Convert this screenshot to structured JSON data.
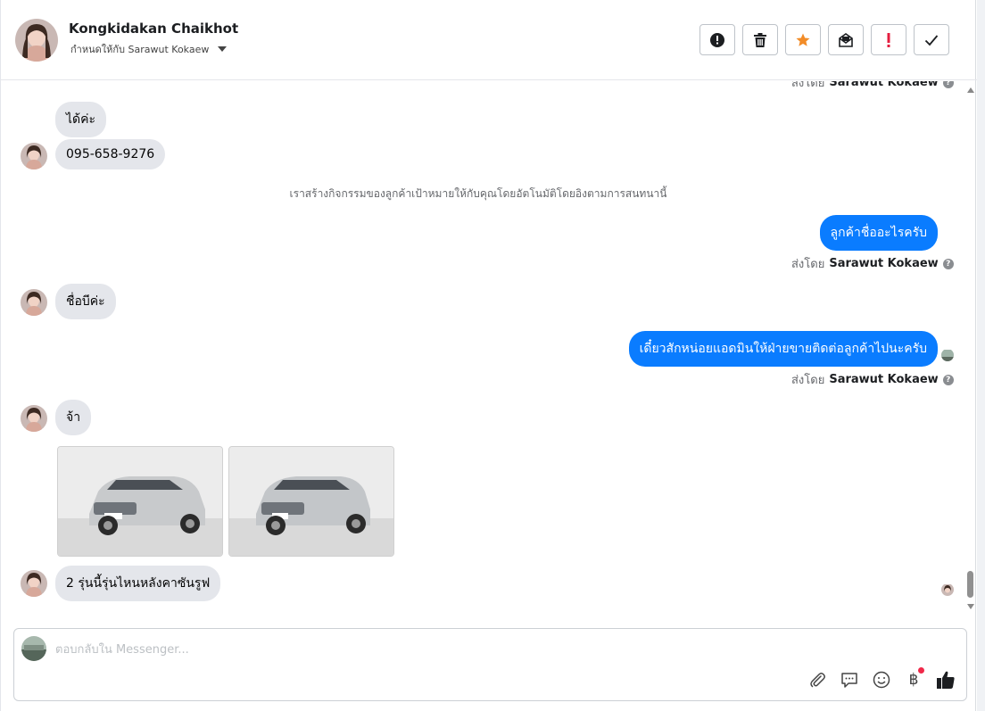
{
  "header": {
    "contact_name": "Kongkidakan Chaikhot",
    "assigned_to": "กำหนดให้กับ Sarawut Kokaew",
    "actions": [
      {
        "icon": "alert-circle-icon",
        "name": "mark-spam-button"
      },
      {
        "icon": "trash-icon",
        "name": "delete-button"
      },
      {
        "icon": "star-icon",
        "name": "star-button"
      },
      {
        "icon": "mail-unread-icon",
        "name": "mark-unread-button"
      },
      {
        "icon": "exclamation-icon",
        "name": "follow-up-button"
      },
      {
        "icon": "check-icon",
        "name": "mark-done-button"
      }
    ]
  },
  "colors": {
    "outgoing_bubble": "#0a7cff",
    "incoming_bubble": "#e4e6eb",
    "star": "#f28c28",
    "alert_red": "#e41e3f"
  },
  "messages": {
    "top_sent_by_prefix": "ส่งโดย",
    "top_sent_by_name": "Sarawut Kokaew",
    "msg1": "ได้ค่ะ",
    "msg2": "095-658-9276",
    "system_note": "เราสร้างกิจกรรมของลูกค้าเป้าหมายให้กับคุณโดยอัตโนมัติโดยอิงตามการสนทนานี้",
    "out1": "ลูกค้าชื่ออะไรครับ",
    "out1_sent_by_prefix": "ส่งโดย",
    "out1_sent_by_name": "Sarawut Kokaew",
    "msg3": "ชื่อบีค่ะ",
    "out2": "เดี๋ยวสักหน่อยแอดมินให้ฝ่ายขายติดต่อลูกค้าไปนะครับ",
    "out2_sent_by_prefix": "ส่งโดย",
    "out2_sent_by_name": "Sarawut Kokaew",
    "msg4": "จ้า",
    "photos": [
      "silver-suv-photo-1",
      "silver-suv-photo-2"
    ],
    "msg5": "2 รุ่นนี้รุ่นไหนหลังคาซันรูฟ"
  },
  "composer": {
    "placeholder": "ตอบกลับใน Messenger...",
    "tools": [
      "paperclip-icon",
      "saved-reply-icon",
      "emoji-icon",
      "baht-payment-icon",
      "thumbs-up-icon"
    ],
    "baht_symbol": "฿"
  }
}
